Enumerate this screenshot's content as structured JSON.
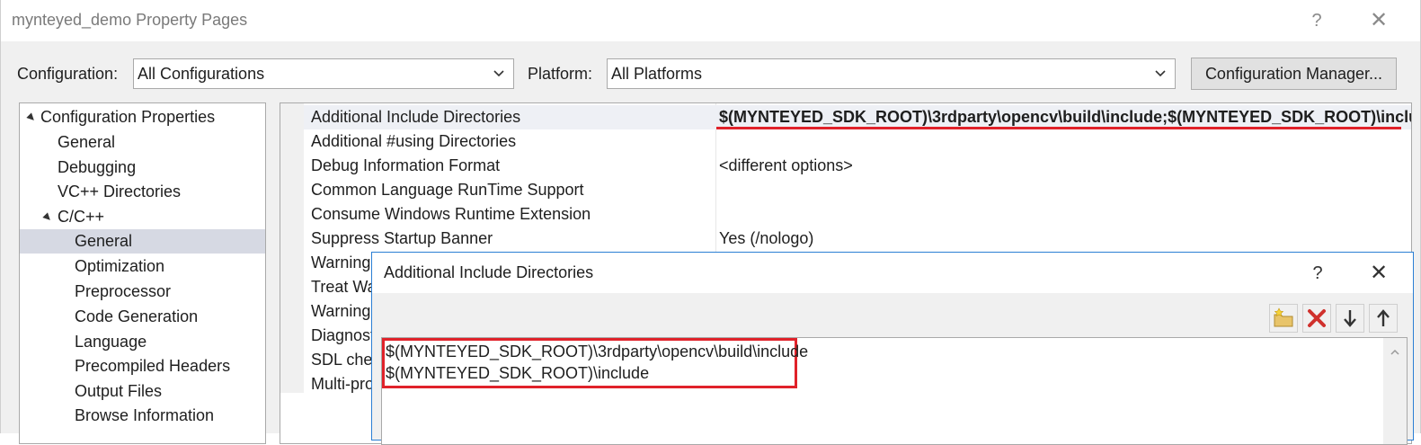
{
  "window": {
    "title": "mynteyed_demo Property Pages",
    "help_glyph": "?",
    "close_glyph": "✕"
  },
  "toolbar": {
    "configuration_label": "Configuration:",
    "configuration_value": "All Configurations",
    "platform_label": "Platform:",
    "platform_value": "All Platforms",
    "config_manager_label": "Configuration Manager..."
  },
  "tree": {
    "items": [
      {
        "label": "Configuration Properties"
      },
      {
        "label": "General"
      },
      {
        "label": "Debugging"
      },
      {
        "label": "VC++ Directories"
      },
      {
        "label": "C/C++"
      },
      {
        "label": "General"
      },
      {
        "label": "Optimization"
      },
      {
        "label": "Preprocessor"
      },
      {
        "label": "Code Generation"
      },
      {
        "label": "Language"
      },
      {
        "label": "Precompiled Headers"
      },
      {
        "label": "Output Files"
      },
      {
        "label": "Browse Information"
      }
    ]
  },
  "grid": {
    "rows": [
      {
        "name": "Additional Include Directories",
        "value": "$(MYNTEYED_SDK_ROOT)\\3rdparty\\opencv\\build\\include;$(MYNTEYED_SDK_ROOT)\\inclu"
      },
      {
        "name": "Additional #using Directories",
        "value": ""
      },
      {
        "name": "Debug Information Format",
        "value": "<different options>"
      },
      {
        "name": "Common Language RunTime Support",
        "value": ""
      },
      {
        "name": "Consume Windows Runtime Extension",
        "value": ""
      },
      {
        "name": "Suppress Startup Banner",
        "value": "Yes (/nologo)"
      },
      {
        "name": "Warning",
        "value": ""
      },
      {
        "name": "Treat Wa",
        "value": ""
      },
      {
        "name": "Warning",
        "value": ""
      },
      {
        "name": "Diagnost",
        "value": ""
      },
      {
        "name": "SDL chec",
        "value": ""
      },
      {
        "name": "Multi-pro",
        "value": ""
      }
    ]
  },
  "dialog": {
    "title": "Additional Include Directories",
    "help_glyph": "?",
    "close_glyph": "✕",
    "lines": [
      "$(MYNTEYED_SDK_ROOT)\\3rdparty\\opencv\\build\\include",
      "$(MYNTEYED_SDK_ROOT)\\include"
    ],
    "tools": [
      "new-folder-icon",
      "delete-icon",
      "move-down-icon",
      "move-up-icon"
    ]
  },
  "colors": {
    "highlight_red": "#e0222a",
    "dialog_border": "#2b7fd4",
    "tree_selected": "#d6d9e3"
  }
}
